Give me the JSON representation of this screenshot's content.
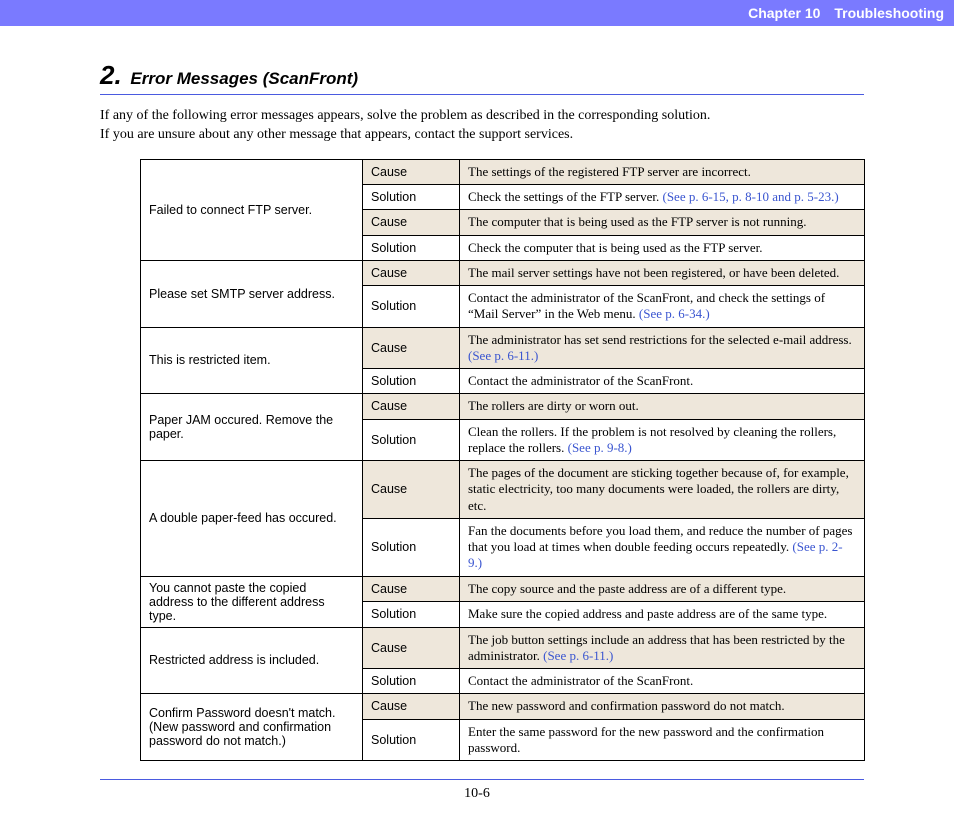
{
  "header": {
    "chapter": "Chapter 10",
    "title": "Troubleshooting"
  },
  "section": {
    "number": "2.",
    "title": "Error Messages (ScanFront)"
  },
  "intro": {
    "line1": "If any of the following error messages appears, solve the problem as described in the corresponding solution.",
    "line2": "If you are unsure about any other message that appears, contact the support services."
  },
  "labels": {
    "cause": "Cause",
    "solution": "Solution"
  },
  "rows": [
    {
      "msg": "Failed to connect FTP server.",
      "items": [
        {
          "type": "cause",
          "text": "The settings of the registered FTP server are incorrect."
        },
        {
          "type": "solution",
          "text": "Check the settings of the FTP server. ",
          "link": "(See p. 6-15, p. 8-10 and p. 5-23.)"
        },
        {
          "type": "cause",
          "text": "The computer that is being used as the FTP server is not running."
        },
        {
          "type": "solution",
          "text": "Check the computer that is being used as the FTP server."
        }
      ]
    },
    {
      "msg": "Please set SMTP server address.",
      "items": [
        {
          "type": "cause",
          "text": "The mail server settings have not been registered, or have been deleted."
        },
        {
          "type": "solution",
          "text": "Contact the administrator of the ScanFront, and check the settings of “Mail Server” in the Web menu. ",
          "link": "(See p. 6-34.)"
        }
      ]
    },
    {
      "msg": "This is restricted item.",
      "items": [
        {
          "type": "cause",
          "text": "The administrator has set send restrictions for the selected e-mail address. ",
          "link": "(See p. 6-11.)"
        },
        {
          "type": "solution",
          "text": "Contact the administrator of the ScanFront."
        }
      ]
    },
    {
      "msg": "Paper JAM occured. Remove the paper.",
      "items": [
        {
          "type": "cause",
          "text": "The rollers are dirty or worn out."
        },
        {
          "type": "solution",
          "text": "Clean the rollers. If the problem is not resolved by cleaning the rollers, replace the rollers. ",
          "link": "(See p. 9-8.)"
        }
      ]
    },
    {
      "msg": "A double paper-feed has occured.",
      "items": [
        {
          "type": "cause",
          "text": "The pages of the document are sticking together because of, for example, static electricity, too many documents were loaded, the rollers are dirty, etc."
        },
        {
          "type": "solution",
          "text": "Fan the documents before you load them, and reduce the number of pages that you load at times when double feeding occurs repeatedly. ",
          "link": "(See p. 2-9.)"
        }
      ]
    },
    {
      "msg": "You cannot paste the copied address to the different address type.",
      "items": [
        {
          "type": "cause",
          "text": "The copy source and the paste address are of a different type."
        },
        {
          "type": "solution",
          "text": "Make sure the copied address and paste address are of the same type."
        }
      ]
    },
    {
      "msg": "Restricted address is included.",
      "items": [
        {
          "type": "cause",
          "text": "The job button settings include an address that has been restricted by the administrator. ",
          "link": "(See p. 6-11.)"
        },
        {
          "type": "solution",
          "text": "Contact the administrator of the ScanFront."
        }
      ]
    },
    {
      "msg": "Confirm Password doesn't match. (New password and confirmation password do not match.)",
      "items": [
        {
          "type": "cause",
          "text": "The new password and confirmation password do not match."
        },
        {
          "type": "solution",
          "text": "Enter the same password for the new password and the confirmation password."
        }
      ]
    }
  ],
  "pagenum": "10-6"
}
